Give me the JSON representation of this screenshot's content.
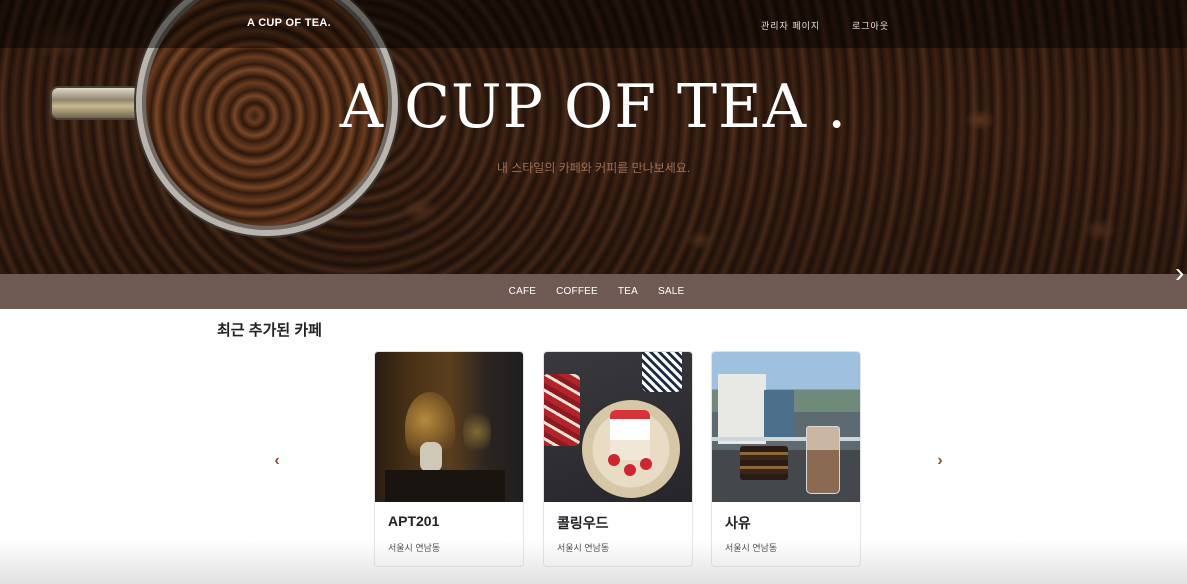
{
  "header": {
    "brand": "A CUP OF TEA.",
    "admin_link": "관리자 페이지",
    "logout_link": "로그아웃"
  },
  "hero": {
    "title": "A CUP OF TEA .",
    "subtitle": "내 스타일의 카페와 커피를 만나보세요.",
    "next_icon": "chevron-right-icon"
  },
  "categories": [
    "CAFE",
    "COFFEE",
    "TEA",
    "SALE"
  ],
  "section": {
    "title": "최근 추가된 카페",
    "prev_icon": "chevron-left-icon",
    "next_icon": "chevron-right-icon"
  },
  "cards": [
    {
      "name": "APT201",
      "address": "서울시 연남동"
    },
    {
      "name": "콜링우드",
      "address": "서울시 연남동"
    },
    {
      "name": "사유",
      "address": "서울시 연남동"
    }
  ],
  "colors": {
    "category_bar": "#6e5a52",
    "arrow": "#8a4f3c",
    "subtitle": "#b07e62"
  }
}
